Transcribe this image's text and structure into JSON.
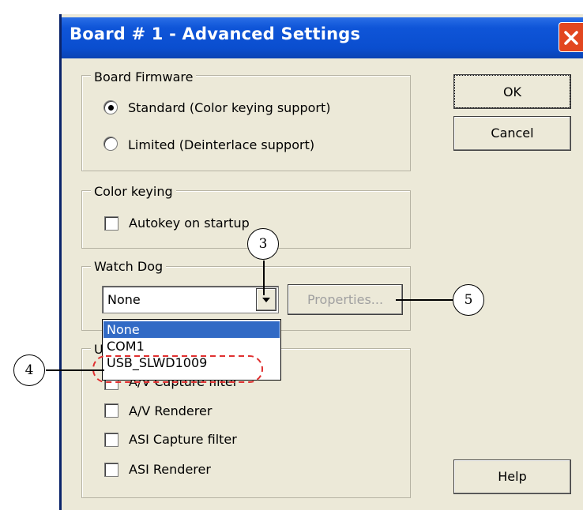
{
  "window": {
    "title": "Board # 1 - Advanced Settings",
    "close_icon": "close-icon"
  },
  "buttons": {
    "ok": "OK",
    "cancel": "Cancel",
    "help": "Help",
    "properties": "Properties..."
  },
  "board_firmware": {
    "legend": "Board Firmware",
    "options": [
      {
        "label": "Standard (Color keying support)",
        "checked": true
      },
      {
        "label": "Limited (Deinterlace support)",
        "checked": false
      }
    ]
  },
  "color_keying": {
    "legend": "Color keying",
    "autokey_label": "Autokey on startup"
  },
  "watch_dog": {
    "legend": "Watch Dog",
    "selected": "None",
    "options": [
      "None",
      "COM1",
      "USB_SLWD1009"
    ]
  },
  "lower_group": {
    "legend_partial": "U",
    "items": [
      "A/V Capture filter",
      "A/V Renderer",
      "ASI Capture filter",
      "ASI Renderer"
    ]
  },
  "callouts": [
    "3",
    "4",
    "5"
  ],
  "colors": {
    "titlebar": "#0a4ecf",
    "selection": "#316ac5",
    "annotation_dash": "#e03030"
  }
}
